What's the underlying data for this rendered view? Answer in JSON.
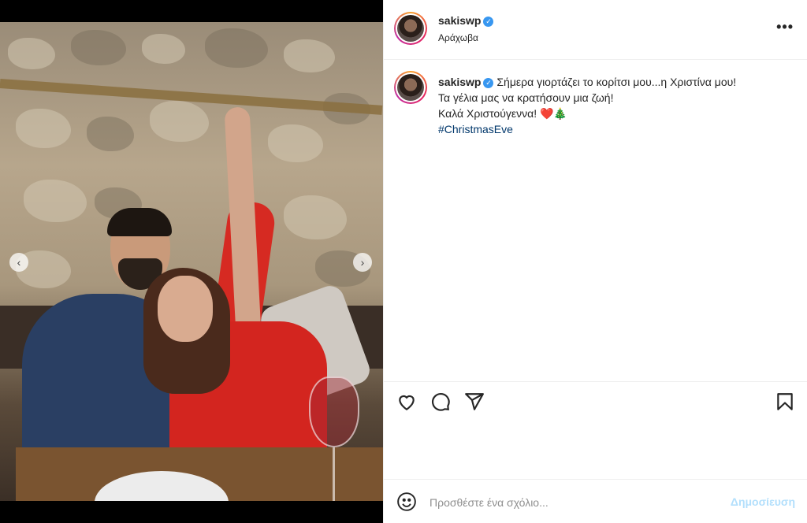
{
  "header": {
    "username": "sakiswp",
    "verified": true,
    "location": "Αράχωβα",
    "more_icon": "more-horizontal-icon"
  },
  "media": {
    "prev_icon": "chevron-left-icon",
    "next_icon": "chevron-right-icon"
  },
  "caption": {
    "username": "sakiswp",
    "line1": "Σήμερα γιορτάζει το κορίτσι μου...η Χριστίνα μου!",
    "line2": "Τα γέλια μας να κρατήσουν μια ζωή!",
    "line3": "Καλά Χριστούγεννα!",
    "emojis": "❤️🎄",
    "hashtag": "#ChristmasEve"
  },
  "actions": {
    "like_icon": "heart-icon",
    "comment_icon": "comment-icon",
    "share_icon": "send-icon",
    "save_icon": "bookmark-icon"
  },
  "comment_bar": {
    "emoji_icon": "smiley-icon",
    "placeholder": "Προσθέστε ένα σχόλιο...",
    "post_label": "Δημοσίευση"
  },
  "colors": {
    "verified": "#3897f0",
    "hashtag": "#00376b",
    "post_disabled": "#b2dffc",
    "border": "#efefef"
  }
}
